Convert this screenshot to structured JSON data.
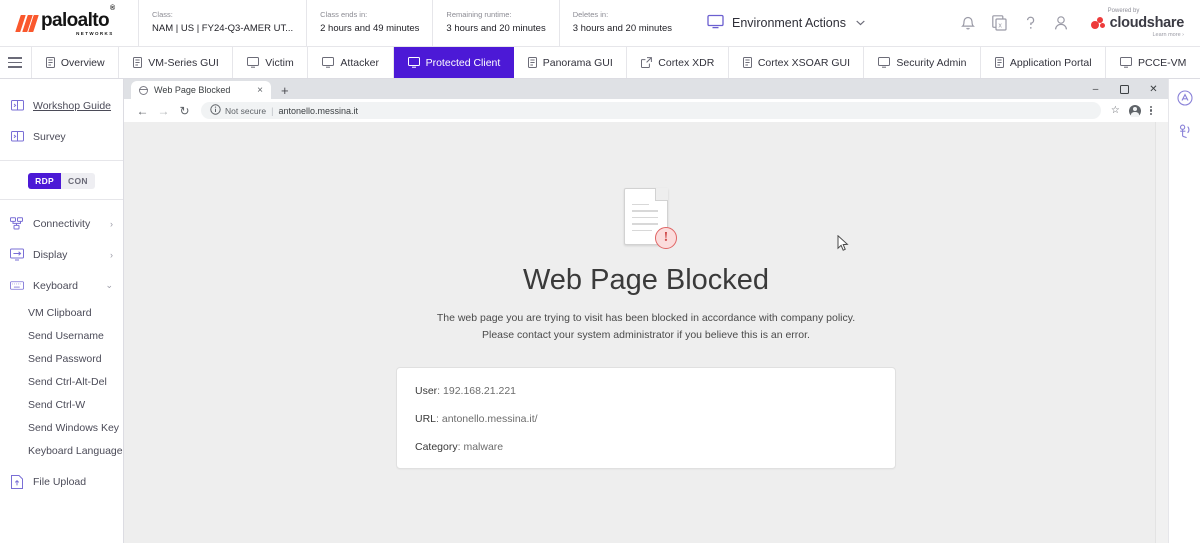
{
  "header": {
    "brand": {
      "name": "paloalto",
      "sub": "NETWORKS",
      "trademark": "®"
    },
    "meta": [
      {
        "label": "Class:",
        "value": "NAM | US | FY24-Q3-AMER UT..."
      },
      {
        "label": "Class ends in:",
        "value": "2 hours and 49 minutes"
      },
      {
        "label": "Remaining runtime:",
        "value": "3 hours and 20 minutes"
      },
      {
        "label": "Deletes in:",
        "value": "3 hours and 20 minutes"
      }
    ],
    "environment_actions": "Environment Actions",
    "caret": "⌄",
    "icons": [
      "bell-icon",
      "copy-vm-icon",
      "help-icon",
      "user-icon"
    ],
    "cloudshare": {
      "powered_by": "Powered by",
      "name": "cloudshare",
      "learn_more": "Learn more ›"
    }
  },
  "vm_tabs": {
    "menu_icon": "hamburger-icon",
    "active": "Protected Client",
    "items": [
      {
        "label": "Overview",
        "icon": "server-icon"
      },
      {
        "label": "VM-Series GUI",
        "icon": "server-icon"
      },
      {
        "label": "Victim",
        "icon": "monitor-icon"
      },
      {
        "label": "Attacker",
        "icon": "monitor-icon"
      },
      {
        "label": "Protected Client",
        "icon": "monitor-icon"
      },
      {
        "label": "Panorama GUI",
        "icon": "server-icon"
      },
      {
        "label": "Cortex XDR",
        "icon": "external-link-icon"
      },
      {
        "label": "Cortex XSOAR GUI",
        "icon": "server-icon"
      },
      {
        "label": "Security Admin",
        "icon": "monitor-icon"
      },
      {
        "label": "Application Portal",
        "icon": "server-icon"
      },
      {
        "label": "PCCE-VM",
        "icon": "monitor-icon"
      }
    ],
    "active_color": "#4c19d6"
  },
  "sidebar": {
    "top_items": [
      {
        "label": "Workshop Guide",
        "icon": "guide-icon",
        "link": true
      },
      {
        "label": "Survey",
        "icon": "survey-icon",
        "link": false
      }
    ],
    "connection_toggle": {
      "options": [
        "RDP",
        "CON"
      ],
      "selected": "RDP"
    },
    "sections": [
      {
        "label": "Connectivity",
        "icon": "connectivity-icon",
        "chevron": "›",
        "expanded": false
      },
      {
        "label": "Display",
        "icon": "display-icon",
        "chevron": "›",
        "expanded": false
      },
      {
        "label": "Keyboard",
        "icon": "keyboard-icon",
        "chevron": "⌄",
        "expanded": true
      }
    ],
    "keyboard_items": [
      "VM Clipboard",
      "Send Username",
      "Send Password",
      "Send Ctrl-Alt-Del",
      "Send Ctrl-W",
      "Send Windows Key",
      "Keyboard Language"
    ],
    "file_upload": {
      "label": "File Upload",
      "icon": "upload-icon"
    }
  },
  "browser": {
    "tab": {
      "title": "Web Page Blocked",
      "favicon": "globe-icon",
      "close": "×"
    },
    "new_tab": "+",
    "window_controls": {
      "minimize": "–",
      "maximize": "❐",
      "close": "✕"
    },
    "nav": {
      "back": "←",
      "forward": "→",
      "reload": "↻"
    },
    "omnibox": {
      "security_label": "Not secure",
      "security_icon": "info-circle-icon",
      "url": "antonello.messina.it",
      "separator": "|"
    },
    "omnibox_actions": {
      "bookmark": "☆",
      "profile": "profile-avatar-icon",
      "menu": "kebab-menu-icon"
    }
  },
  "blocked_page": {
    "icon": "blocked-document-icon",
    "alert_glyph": "!",
    "title": "Web Page Blocked",
    "description": "The web page you are trying to visit has been blocked in accordance with company policy. Please contact your system administrator if you believe this is an error.",
    "details": [
      {
        "label": "User",
        "value": "192.168.21.221"
      },
      {
        "label": "URL",
        "value": "antonello.messina.it/"
      },
      {
        "label": "Category",
        "value": "malware"
      }
    ],
    "background_color": "#eeeeee"
  },
  "right_rail": {
    "icons": [
      {
        "name": "support-chat-icon"
      },
      {
        "name": "accessibility-icon"
      }
    ]
  }
}
